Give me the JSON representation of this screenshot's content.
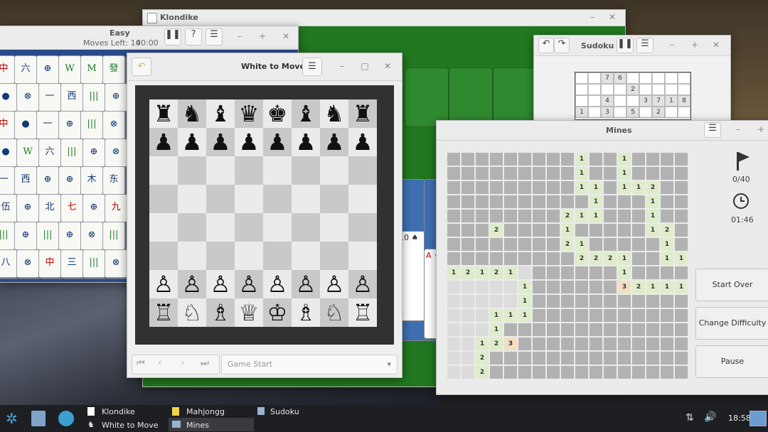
{
  "mahjongg": {
    "title": "Easy",
    "moves_left": "Moves Left: 14",
    "timer": "00:00",
    "tiles": [
      "中",
      "六",
      "⊕",
      "W",
      "M",
      "發",
      "●",
      "⊗",
      "一",
      "西",
      "|||",
      "⊕",
      "中",
      "●",
      "一",
      "⊕",
      "|||",
      "⊗",
      "●",
      "W",
      "六",
      "|||",
      "⊕",
      "⊗",
      "一",
      "西",
      "⊕",
      "⊕",
      "木",
      "东",
      "伍",
      "⊕",
      "北",
      "七",
      "⊕",
      "九",
      "|||",
      "⊕",
      "|||",
      "⊕",
      "⊗",
      "|||",
      "八",
      "⊗",
      "中",
      "三",
      "|||",
      "⊗"
    ]
  },
  "klondike": {
    "title": "Klondike",
    "cards": [
      "10 ♠",
      "A ♦",
      "10 ♠",
      "A ♦"
    ]
  },
  "chess": {
    "title": "White to Move",
    "history": "Game Start",
    "rows": [
      [
        "♜",
        "♞",
        "♝",
        "♛",
        "♚",
        "♝",
        "♞",
        "♜"
      ],
      [
        "♟",
        "♟",
        "♟",
        "♟",
        "♟",
        "♟",
        "♟",
        "♟"
      ],
      [
        "",
        "",
        "",
        "",
        "",
        "",
        "",
        ""
      ],
      [
        "",
        "",
        "",
        "",
        "",
        "",
        "",
        ""
      ],
      [
        "",
        "",
        "",
        "",
        "",
        "",
        "",
        ""
      ],
      [
        "",
        "",
        "",
        "",
        "",
        "",
        "",
        ""
      ],
      [
        "♙",
        "♙",
        "♙",
        "♙",
        "♙",
        "♙",
        "♙",
        "♙"
      ],
      [
        "♖",
        "♘",
        "♗",
        "♕",
        "♔",
        "♗",
        "♘",
        "♖"
      ]
    ]
  },
  "sudoku": {
    "title": "Sudoku",
    "rows": [
      [
        "",
        "",
        "7",
        "6",
        "",
        "",
        "",
        "",
        ""
      ],
      [
        "",
        "",
        "",
        "",
        "2",
        "",
        "",
        "",
        ""
      ],
      [
        "",
        "",
        "4",
        "",
        "",
        "3",
        "7",
        "1",
        "8"
      ],
      [
        "1",
        "",
        "3",
        "",
        "5",
        "",
        "2",
        "",
        ""
      ]
    ]
  },
  "mines": {
    "title": "Mines",
    "flags": "0/40",
    "time": "01:46",
    "start_over": "Start Over",
    "change_difficulty": "Change Difficulty",
    "pause": "Pause",
    "rows": [
      "#########1##1####",
      "#########1##1####",
      "#########11#112##",
      "##########1###1##",
      "########211###1##",
      "###2####1#####12#",
      "########21#####1#",
      "#########2221##11",
      "12121 ######1####",
      "     1######32111",
      "     1###########",
      "   111###########",
      "   1#############",
      "  123############",
      "  2##############",
      "  2##############"
    ]
  },
  "taskbar": {
    "items": [
      "Klondike",
      "White to Move",
      "Mahjongg",
      "Mines",
      "Sudoku"
    ],
    "clock": "18:58"
  }
}
